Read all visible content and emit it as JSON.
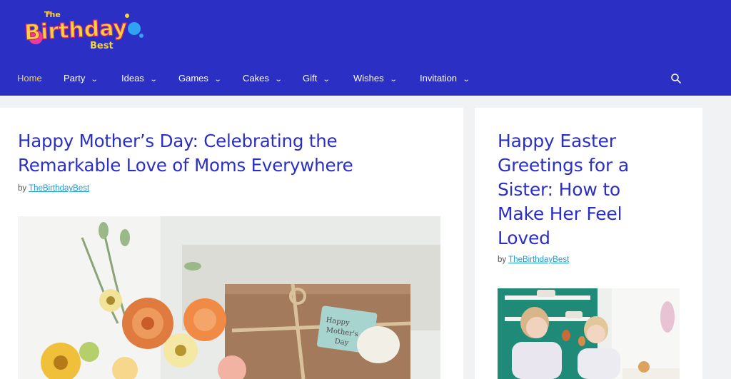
{
  "brand": {
    "logo_line1": "The",
    "logo_line2": "Birthday",
    "logo_line3": "Best",
    "colors": {
      "header_bg": "#2b2fc4",
      "active_nav": "#f5d33c",
      "title": "#2b2fc4",
      "link": "#1e9bd7"
    }
  },
  "nav": {
    "items": [
      {
        "label": "Home",
        "icon": ""
      },
      {
        "label": "Party",
        "icon": "chevron-down-icon"
      },
      {
        "label": "Ideas",
        "icon": "chevron-down-icon"
      },
      {
        "label": "Games",
        "icon": "chevron-down-icon"
      },
      {
        "label": "Cakes",
        "icon": "chevron-down-icon"
      },
      {
        "label": "Gift",
        "icon": "chevron-down-icon"
      },
      {
        "label": "Wishes",
        "icon": "chevron-down-icon"
      },
      {
        "label": "Invitation",
        "icon": "chevron-down-icon"
      }
    ],
    "search_icon": "search-icon"
  },
  "main_post": {
    "title_line1": "Happy Mother’s Day: Celebrating the",
    "title_line2": "Remarkable Love of Moms Everywhere",
    "by": "by",
    "author": "TheBirthdayBest",
    "image_text_line1": "Happy",
    "image_text_line2": "Mother's",
    "image_text_line3": "Day"
  },
  "side_post": {
    "title_line1": "Happy Easter",
    "title_line2": "Greetings for a",
    "title_line3": "Sister: How to",
    "title_line4": "Make Her Feel",
    "title_line5": "Loved",
    "by": "by",
    "author": "TheBirthdayBest"
  }
}
